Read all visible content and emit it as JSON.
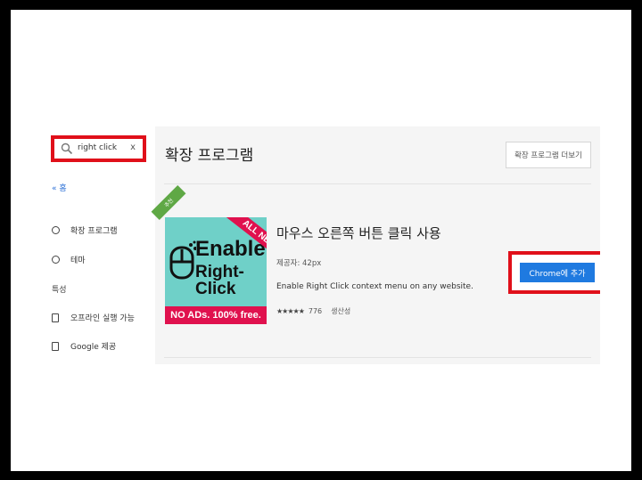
{
  "search": {
    "query": "right click",
    "clear_label": "x"
  },
  "sidebar": {
    "home_label": "« 홈",
    "categories": [
      {
        "label": "확장 프로그램"
      },
      {
        "label": "테마"
      }
    ],
    "features_heading": "특성",
    "features": [
      {
        "label": "오프라인 실행 가능"
      },
      {
        "label": "Google 제공"
      }
    ]
  },
  "main": {
    "title": "확장 프로그램",
    "more_button": "확장 프로그램 더보기"
  },
  "extension": {
    "name": "마우스 오른쪽 버튼 클릭 사용",
    "provider": "제공자: 42px",
    "description": "Enable Right Click context menu on any website.",
    "stars": "★★★★★",
    "rating_count": "776",
    "category": "생산성",
    "add_button": "Chrome에 추가",
    "flag_label": "추천",
    "thumbnail": {
      "line1": "Enable",
      "line2": "Right-Click",
      "ribbon": "ALL NEW",
      "band": "NO ADs. 100% free."
    }
  },
  "colors": {
    "highlight": "#e0101a",
    "accent_blue": "#1f7ae0",
    "thumb_bg": "#6fd0c8",
    "thumb_band": "#e0114e"
  }
}
